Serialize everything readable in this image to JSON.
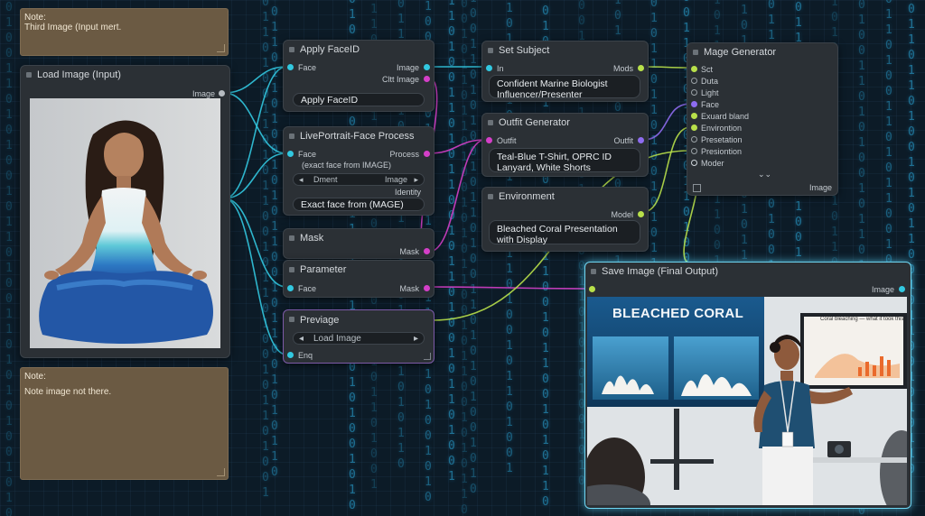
{
  "notes": {
    "top": {
      "label": "Note:",
      "text": "Third Image (Input mert."
    },
    "bottom": {
      "label": "Note:",
      "text": "Note image not there."
    }
  },
  "load_image": {
    "title": "Load Image (Input)",
    "out_image": "Image"
  },
  "apply_faceid": {
    "title": "Apply FaceID",
    "in_face": "Face",
    "out_image": "Image",
    "out_cltt": "Cltt Image",
    "field": "Apply FaceID"
  },
  "liveportrait": {
    "title": "LivePortrait-Face Process",
    "in_face": "Face",
    "out_process": "Process",
    "subtitle": "(exact face from IMAGE)",
    "select_left": "Dment",
    "select_right": "Image",
    "identity": "Identity",
    "field": "Exact face from (MAGE)"
  },
  "mask": {
    "title": "Mask",
    "out_mask": "Mask"
  },
  "parameter": {
    "title": "Parameter",
    "in_face": "Face",
    "out_mask": "Mask"
  },
  "previage": {
    "title": "Previage",
    "select": "Load Image",
    "in_enq": "Enq"
  },
  "set_subject": {
    "title": "Set Subject",
    "in": "In",
    "out": "Mods",
    "field": "Confident Marine Biologist Influencer/Presenter"
  },
  "outfit": {
    "title": "Outfit Generator",
    "in": "Outfit",
    "out": "Outfit",
    "field": "Teal-Blue T-Shirt, OPRC ID Lanyard, White Shorts"
  },
  "environment": {
    "title": "Environment",
    "out": "Model",
    "field": "Bleached Coral Presentation with Display"
  },
  "mage_generator": {
    "title": "Mage Generator",
    "inputs": [
      "Sct",
      "Duta",
      "Light",
      "Face",
      "Exuard bland",
      "Environtion",
      "Presetation",
      "Presiontion",
      "Moder"
    ],
    "out_image": "Image"
  },
  "save_image": {
    "title": "Save Image (Final Output)",
    "out_image": "Image"
  },
  "output_scene": {
    "banner": "BLEACHED CORAL",
    "screen_title": "Coral bleaching — what it took this"
  },
  "rain_text": [
    "0\n1\n0\n0\n1\n1\n0\n1\n0\n1\n0\n0\n1\n0\n1\n1\n0\n1\n0\n0\n1\n1\n0\n1\n0\n1\n0\n1\n0\n0\n1\n0\n1\n0",
    "1\n0\n1\n1\n0\n1\n0\n0\n1\n1\n0\n1\n0\n1\n1\n0\n0\n1\n0\n1\n1\n0\n1\n0\n0\n1\n0\n1\n1\n0\n1\n0\n0\n1",
    "0\n0\n1\n0\n1\n1\n0\n1\n1\n0\n1\n0\n0\n1\n0\n1\n0\n1\n1\n0\n0\n1\n0\n1\n1\n0\n0\n1\n0\n1\n0\n1\n1\n0"
  ],
  "colors": {
    "cyan": "#32c8e0",
    "magenta": "#d43fc8",
    "lime": "#b8e04a",
    "purple": "#8e6cf0",
    "node_bg": "#2b3035"
  }
}
